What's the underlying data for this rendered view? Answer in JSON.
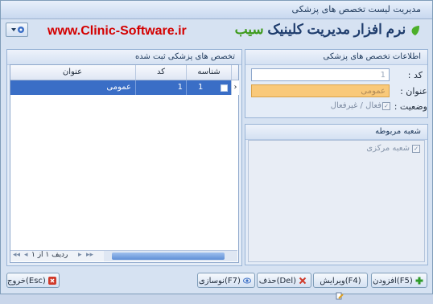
{
  "window": {
    "title": "مدیریت لیست تخصص های پزشکی"
  },
  "header": {
    "url": "www.Clinic-Software.ir",
    "logo_main": "نرم افزار مدیریت کلینیک",
    "logo_accent": "سیب"
  },
  "grid_panel": {
    "title": "تخصص های پزشکی ثبت شده",
    "columns": [
      "شناسه",
      "کد",
      "عنوان"
    ],
    "rows": [
      {
        "id": "1",
        "code": "1",
        "title": "عمومی"
      }
    ],
    "navigator": "ردیف ۱ از ۱"
  },
  "info_panel": {
    "title": "اطلاعات تخصص های پزشکی",
    "code_label": "کد :",
    "code_value": "1",
    "title_label": "عنوان :",
    "title_value": "عمومی",
    "status_label": "وضعیت :",
    "status_value": "فعال / غیرفعال"
  },
  "branch_panel": {
    "title": "شعبه مربوطه",
    "branches": [
      "شعبه مرکزی"
    ]
  },
  "buttons": {
    "add": "افزودن(F5)",
    "edit": "ویرایش(F4)",
    "delete": "حذف(Del)",
    "refresh": "نوسازی(F7)",
    "exit": "خروج(Esc)"
  },
  "colors": {
    "accent": "#3a6ec6",
    "url_red": "#d40000",
    "title_input": "#f9c97a"
  }
}
